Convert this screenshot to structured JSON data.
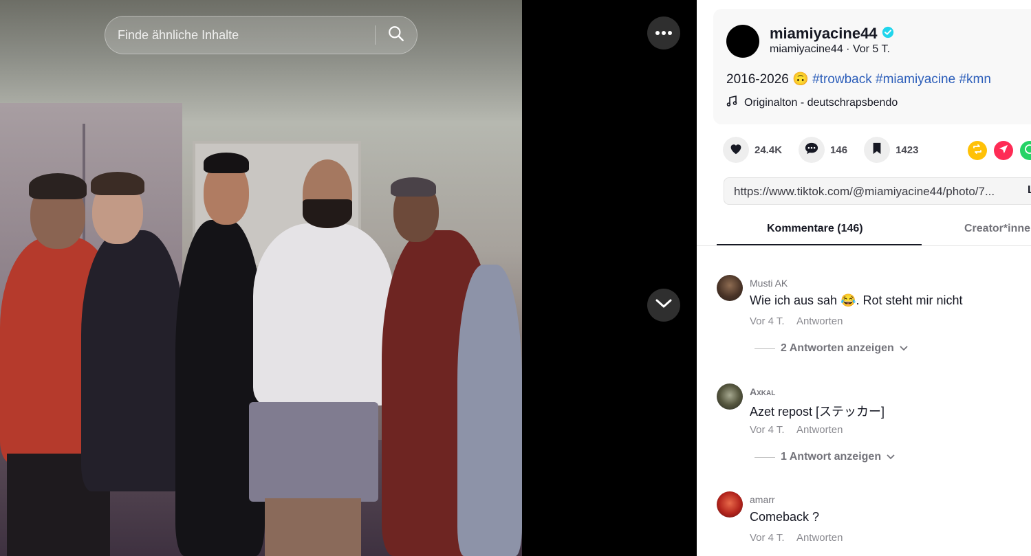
{
  "search": {
    "placeholder": "Finde ähnliche Inhalte"
  },
  "author": {
    "display_name": "miamiyacine44",
    "handle": "miamiyacine44",
    "time": "Vor 5 T.",
    "verified": true
  },
  "caption": {
    "text": "2016-2026 ",
    "emoji": "🙃",
    "tags": [
      "#trowback",
      "#miamiyacine",
      "#kmn"
    ]
  },
  "music": {
    "label": "Originalton - deutschrapsbendo"
  },
  "stats": {
    "likes": "24.4K",
    "comments": "146",
    "saves": "1423"
  },
  "link": {
    "url": "https://www.tiktok.com/@miamiyacine44/photo/7...",
    "copy_label": "L"
  },
  "tabs": {
    "comments": "Kommentare (146)",
    "creator": "Creator*innen"
  },
  "comments": [
    {
      "user": "Musti AK",
      "text": "Wie ich aus sah 😂. Rot steht mir nicht",
      "time": "Vor 4 T.",
      "reply": "Antworten",
      "more": "2 Antworten anzeigen"
    },
    {
      "user": "Axkal",
      "text": "Azet repost [ステッカー]",
      "time": "Vor 4 T.",
      "reply": "Antworten",
      "more": "1 Antwort anzeigen"
    },
    {
      "user": "amarr",
      "text": "Comeback ?",
      "time": "Vor 4 T.",
      "reply": "Antworten",
      "more": ""
    }
  ],
  "colors": {
    "accent_link": "#2b5db9",
    "verified": "#20d5ec",
    "repost": "#ffc107",
    "send": "#fe2c55",
    "whatsapp": "#25d366"
  },
  "icons": [
    "search-icon",
    "more-icon",
    "chevron-down-icon",
    "verified-icon",
    "music-note-icon",
    "heart-icon",
    "comment-icon",
    "bookmark-icon",
    "repost-icon",
    "send-icon",
    "whatsapp-icon"
  ]
}
